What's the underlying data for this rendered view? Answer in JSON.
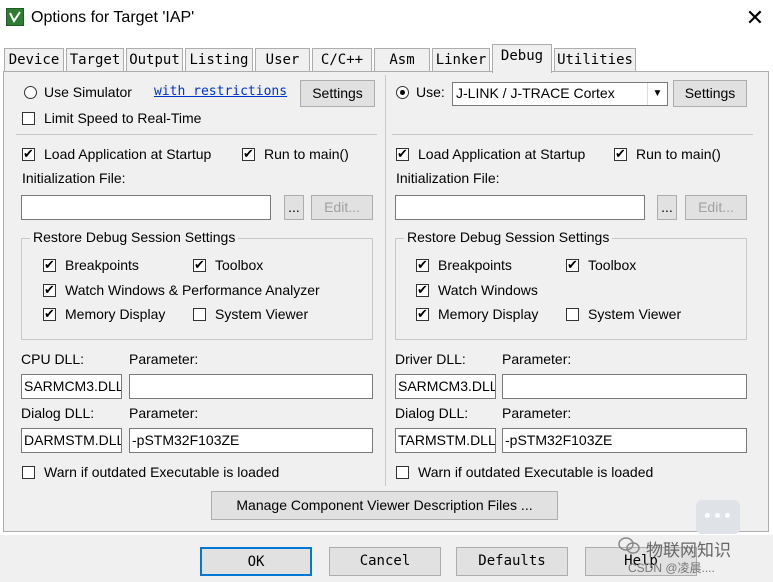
{
  "window": {
    "title": "Options for Target 'IAP'"
  },
  "tabs": [
    {
      "label": "Device"
    },
    {
      "label": "Target"
    },
    {
      "label": "Output"
    },
    {
      "label": "Listing"
    },
    {
      "label": "User"
    },
    {
      "label": "C/C++"
    },
    {
      "label": "Asm"
    },
    {
      "label": "Linker"
    },
    {
      "label": "Debug"
    },
    {
      "label": "Utilities"
    }
  ],
  "left": {
    "use_simulator": "Use Simulator",
    "with_restrictions": "with restrictions",
    "settings": "Settings",
    "limit_speed": "Limit Speed to Real-Time",
    "load_app": "Load Application at Startup",
    "run_to_main": "Run to main()",
    "init_file": "Initialization File:",
    "browse": "...",
    "edit": "Edit...",
    "restore_title": "Restore Debug Session Settings",
    "breakpoints": "Breakpoints",
    "toolbox": "Toolbox",
    "watch": "Watch Windows & Performance Analyzer",
    "memory": "Memory Display",
    "system_viewer": "System Viewer",
    "cpu_dll_label": "CPU DLL:",
    "cpu_param_label": "Parameter:",
    "cpu_dll": "SARMCM3.DLL",
    "cpu_param": "",
    "dialog_dll_label": "Dialog DLL:",
    "dialog_param_label": "Parameter:",
    "dialog_dll": "DARMSTM.DLL",
    "dialog_param": "-pSTM32F103ZE",
    "warn": "Warn if outdated Executable is loaded"
  },
  "right": {
    "use": "Use:",
    "debugger": "J-LINK / J-TRACE Cortex",
    "settings": "Settings",
    "load_app": "Load Application at Startup",
    "run_to_main": "Run to main()",
    "init_file": "Initialization File:",
    "browse": "...",
    "edit": "Edit...",
    "restore_title": "Restore Debug Session Settings",
    "breakpoints": "Breakpoints",
    "toolbox": "Toolbox",
    "watch": "Watch Windows",
    "memory": "Memory Display",
    "system_viewer": "System Viewer",
    "driver_dll_label": "Driver DLL:",
    "driver_param_label": "Parameter:",
    "driver_dll": "SARMCM3.DLL",
    "driver_param": "",
    "dialog_dll_label": "Dialog DLL:",
    "dialog_param_label": "Parameter:",
    "dialog_dll": "TARMSTM.DLL",
    "dialog_param": "-pSTM32F103ZE",
    "warn": "Warn if outdated Executable is loaded"
  },
  "manage_button": "Manage Component Viewer Description Files ...",
  "footer": {
    "ok": "OK",
    "cancel": "Cancel",
    "defaults": "Defaults",
    "help": "Help"
  },
  "watermark": {
    "line1": "物联网知识",
    "line2": "CSDN @凌晨...."
  },
  "icons": {
    "app": "keil-logo-icon",
    "close": "close-icon",
    "dropdown": "chevron-down-icon",
    "chat": "wechat-icon"
  }
}
